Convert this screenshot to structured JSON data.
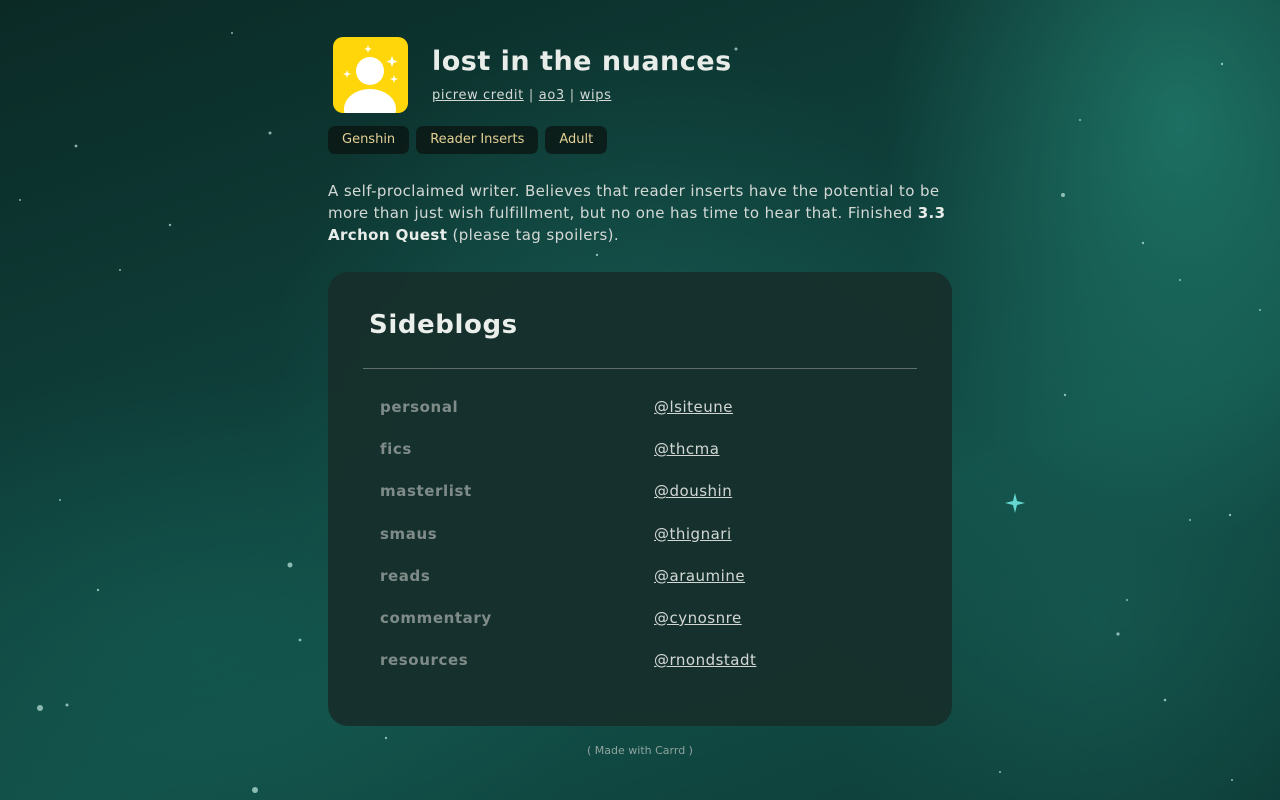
{
  "profile": {
    "title": "lost in the nuances",
    "avatar_icon": "user-avatar-icon",
    "avatar_color": "#ffd60a",
    "links": [
      {
        "label": "picrew credit"
      },
      {
        "label": "ao3"
      },
      {
        "label": "wips"
      }
    ],
    "separator": "|"
  },
  "tags": [
    "Genshin",
    "Reader Inserts",
    "Adult"
  ],
  "bio": {
    "text_1": "A self-proclaimed writer. Believes that reader inserts have the potential to be more than just wish fulfillment, but no one has time to hear that. Finished ",
    "bold": "3.3 Archon Quest",
    "text_2": " (please tag spoilers)."
  },
  "sideblogs": {
    "title": "Sideblogs",
    "rows": [
      {
        "label": "personal",
        "handle": "@lsiteune"
      },
      {
        "label": "fics",
        "handle": "@thcma"
      },
      {
        "label": "masterlist",
        "handle": "@doushin"
      },
      {
        "label": "smaus",
        "handle": "@thignari"
      },
      {
        "label": "reads",
        "handle": "@araumine"
      },
      {
        "label": "commentary",
        "handle": "@cynosnre"
      },
      {
        "label": "resources",
        "handle": "@rnondstadt"
      }
    ]
  },
  "footer": "( Made with Carrd )",
  "colors": {
    "background": "#0f3f3a",
    "card": "#172e2b",
    "tag_text": "#e2cf95"
  }
}
